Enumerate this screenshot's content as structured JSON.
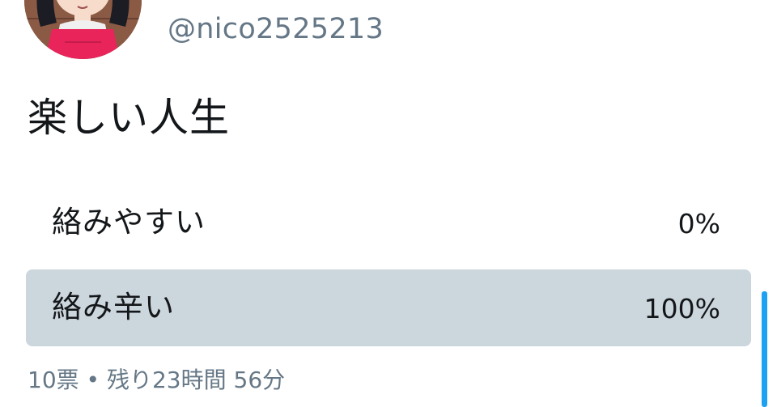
{
  "tweet": {
    "handle": "@nico2525213",
    "text": "楽しい人生"
  },
  "poll": {
    "options": [
      {
        "label": "絡みやすい",
        "percent_text": "0%",
        "percent": 0
      },
      {
        "label": "絡み辛い",
        "percent_text": "100%",
        "percent": 100
      }
    ],
    "votes": "10票",
    "separator": "•",
    "remaining": "残り23時間 56分"
  },
  "colors": {
    "text_primary": "#14171a",
    "text_secondary": "#657786",
    "poll_fill": "#ccd6dd",
    "accent": "#1da1f2"
  }
}
